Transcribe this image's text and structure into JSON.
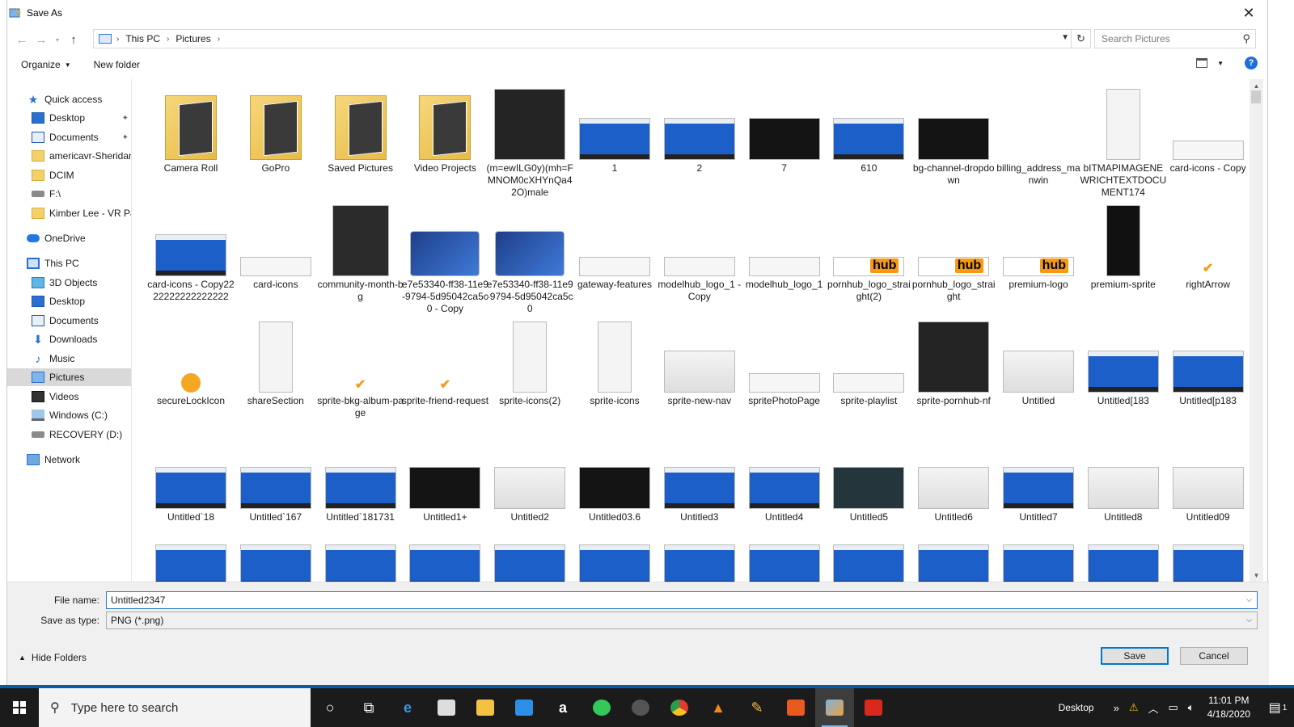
{
  "window": {
    "title": "Save As",
    "close": "✕"
  },
  "address": {
    "crumbs": [
      "This PC",
      "Pictures"
    ],
    "search_placeholder": "Search Pictures"
  },
  "toolbar": {
    "organize": "Organize",
    "new_folder": "New folder",
    "help": "?"
  },
  "nav": {
    "quick_access": "Quick access",
    "items": [
      {
        "label": "Quick access"
      },
      {
        "label": "Desktop"
      },
      {
        "label": "Documents"
      },
      {
        "label": "americavr-Sheridan"
      },
      {
        "label": "DCIM"
      },
      {
        "label": "F:\\"
      },
      {
        "label": "Kimber Lee - VR Pac"
      },
      {
        "label": "OneDrive"
      },
      {
        "label": "This PC"
      },
      {
        "label": "3D Objects"
      },
      {
        "label": "Desktop"
      },
      {
        "label": "Documents"
      },
      {
        "label": "Downloads"
      },
      {
        "label": "Music"
      },
      {
        "label": "Pictures"
      },
      {
        "label": "Videos"
      },
      {
        "label": "Windows (C:)"
      },
      {
        "label": "RECOVERY (D:)"
      },
      {
        "label": "Network"
      }
    ]
  },
  "files": [
    {
      "name": "Camera Roll"
    },
    {
      "name": "GoPro"
    },
    {
      "name": "Saved Pictures"
    },
    {
      "name": "Video Projects"
    },
    {
      "name": "(m=ewILG0y)(mh=FMNOM0cXHYnQa42O)male"
    },
    {
      "name": "1"
    },
    {
      "name": "2"
    },
    {
      "name": "7"
    },
    {
      "name": "610"
    },
    {
      "name": "bg-channel-dropdown"
    },
    {
      "name": "billing_address_manwin"
    },
    {
      "name": "bITMAPIMAGENEWRICHTEXTDOCUMENT174"
    },
    {
      "name": "card-icons - Copy"
    },
    {
      "name": "card-icons - Copy2222222222222222"
    },
    {
      "name": "card-icons"
    },
    {
      "name": "community-month-bg"
    },
    {
      "name": "e7e53340-ff38-11e9-9794-5d95042ca5c0 - Copy"
    },
    {
      "name": "e7e53340-ff38-11e9-9794-5d95042ca5c0"
    },
    {
      "name": "gateway-features"
    },
    {
      "name": "modelhub_logo_1 - Copy"
    },
    {
      "name": "modelhub_logo_1"
    },
    {
      "name": "pornhub_logo_straight(2)"
    },
    {
      "name": "pornhub_logo_straight"
    },
    {
      "name": "premium-logo"
    },
    {
      "name": "premium-sprite"
    },
    {
      "name": "rightArrow"
    },
    {
      "name": "secureLockIcon"
    },
    {
      "name": "shareSection"
    },
    {
      "name": "sprite-bkg-album-page"
    },
    {
      "name": "sprite-friend-request"
    },
    {
      "name": "sprite-icons(2)"
    },
    {
      "name": "sprite-icons"
    },
    {
      "name": "sprite-new-nav"
    },
    {
      "name": "spritePhotoPage"
    },
    {
      "name": "sprite-playlist"
    },
    {
      "name": "sprite-pornhub-nf"
    },
    {
      "name": "Untitled"
    },
    {
      "name": "Untitled[183"
    },
    {
      "name": "Untitled[p183"
    },
    {
      "name": "Untitled`18"
    },
    {
      "name": "Untitled`167"
    },
    {
      "name": "Untitled`181731"
    },
    {
      "name": "Untitled1+"
    },
    {
      "name": "Untitled2"
    },
    {
      "name": "Untitled03.6"
    },
    {
      "name": "Untitled3"
    },
    {
      "name": "Untitled4"
    },
    {
      "name": "Untitled5"
    },
    {
      "name": "Untitled6"
    },
    {
      "name": "Untitled7"
    },
    {
      "name": "Untitled8"
    },
    {
      "name": "Untitled09"
    }
  ],
  "bottom": {
    "file_name_label": "File name:",
    "file_name_value": "Untitled2347",
    "save_type_label": "Save as type:",
    "save_type_value": "PNG (*.png)",
    "hide_folders": "Hide Folders",
    "save": "Save",
    "cancel": "Cancel"
  },
  "taskbar": {
    "search_placeholder": "Type here to search",
    "desktop_label": "Desktop",
    "time": "11:01 PM",
    "date": "4/18/2020",
    "notifications": "1"
  }
}
